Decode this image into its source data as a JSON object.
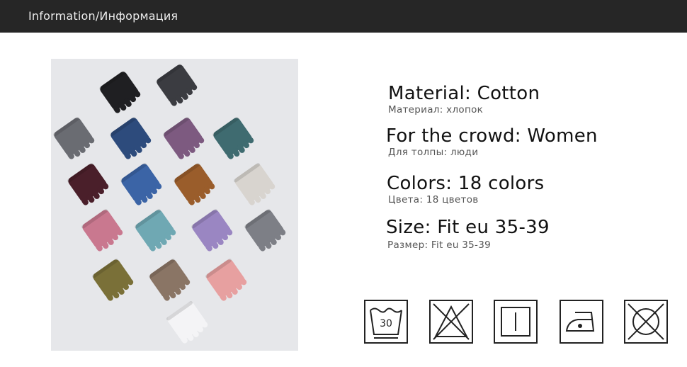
{
  "header": {
    "title": "Information/Информация"
  },
  "specs": [
    {
      "main": "Material: Cotton",
      "sub": "Материал: хлопок"
    },
    {
      "main": "For the crowd: Women",
      "sub": "Для толпы: люди"
    },
    {
      "main": "Colors: 18 colors",
      "sub": "Цвета: 18 цветов"
    },
    {
      "main": "Size: Fit eu 35-39",
      "sub": "Размер: Fit eu 35-39"
    }
  ],
  "care_icons": [
    {
      "icon": "wash-30-icon",
      "label": "30"
    },
    {
      "icon": "do-not-bleach-icon"
    },
    {
      "icon": "dry-flat-icon"
    },
    {
      "icon": "iron-low-heat-icon"
    },
    {
      "icon": "do-not-tumble-dry-icon"
    }
  ],
  "sock_colors": [
    "#1f1f22",
    "#3b3c41",
    "#6a6c72",
    "#2d4b7c",
    "#7d5a80",
    "#3f6b70",
    "#4a1f2a",
    "#3b64a6",
    "#9a5d2b",
    "#d8d4cf",
    "#c9788f",
    "#6fa8b3",
    "#9a86c2",
    "#7d7f86",
    "#7a7038",
    "#8a7565",
    "#e7a0a0",
    "#f4f4f6"
  ]
}
